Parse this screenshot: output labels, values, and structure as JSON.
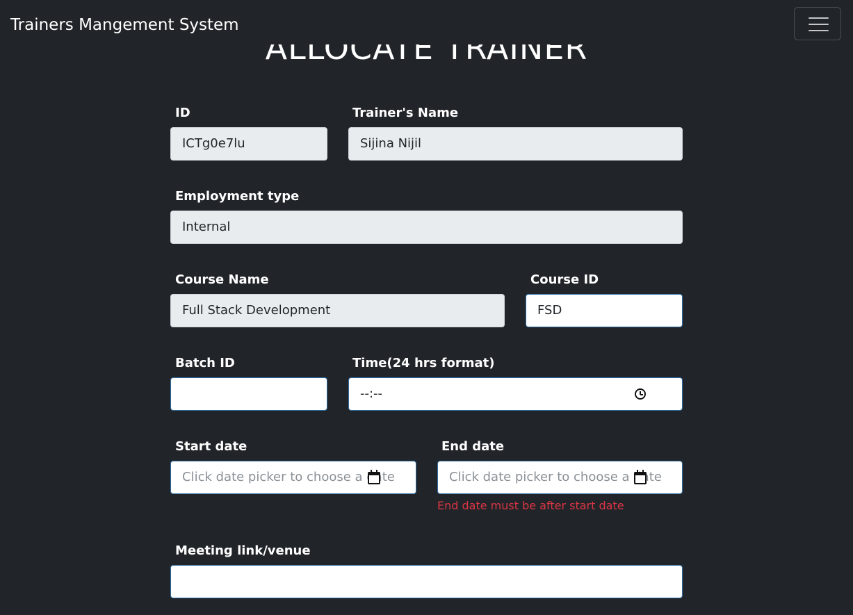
{
  "navbar": {
    "brand": "Trainers Mangement System",
    "toggler_icon": "hamburger-menu-icon"
  },
  "page": {
    "title": "ALLOCATE TRAINER"
  },
  "form": {
    "id": {
      "label": "ID",
      "value": "ICTg0e7lu"
    },
    "trainer_name": {
      "label": "Trainer's Name",
      "value": "Sijina Nijil"
    },
    "employment_type": {
      "label": "Employment type",
      "value": "Internal"
    },
    "course_name": {
      "label": "Course Name",
      "value": "Full Stack Development"
    },
    "course_id": {
      "label": "Course ID",
      "value": "FSD"
    },
    "batch_id": {
      "label": "Batch ID",
      "value": ""
    },
    "time": {
      "label": "Time(24 hrs format)",
      "value": "--:--",
      "icon": "clock-icon"
    },
    "start_date": {
      "label": "Start date",
      "placeholder": "Click date picker to choose a date",
      "icon": "calendar-icon"
    },
    "end_date": {
      "label": "End date",
      "placeholder": "Click date picker to choose a date",
      "icon": "calendar-icon",
      "error": "End date must be after start date"
    },
    "meeting_link": {
      "label": "Meeting link/venue",
      "value": ""
    }
  },
  "colors": {
    "background": "#212529",
    "readonly_field": "#e9ecef",
    "field_border": "#2f6fa8",
    "error": "#dc3545"
  }
}
